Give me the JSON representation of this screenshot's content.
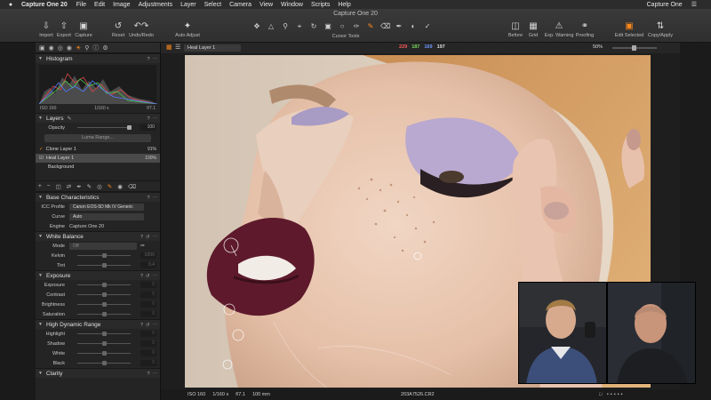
{
  "menubar": {
    "app_name": "Capture One 20",
    "items": [
      "File",
      "Edit",
      "Image",
      "Adjustments",
      "Layer",
      "Select",
      "Camera",
      "View",
      "Window",
      "Scripts",
      "Help"
    ],
    "right_title": "Capture One"
  },
  "toolbar": {
    "window_title": "Capture One 20",
    "left_buttons": [
      "Import",
      "Export",
      "Capture",
      "Reset",
      "Undo/Redo",
      "Auto Adjust"
    ],
    "cursor_tools_label": "Cursor Tools",
    "right_buttons": [
      "Before",
      "Grid",
      "Exp. Warning",
      "Proofing",
      "Edit Selected",
      "Copy/Apply"
    ]
  },
  "histogram": {
    "title": "Histogram",
    "iso": "ISO 160",
    "shutter": "1/160 s",
    "aperture": "f/7.1"
  },
  "layers": {
    "title": "Layers",
    "opacity_label": "Opacity",
    "opacity_value": "100",
    "luma_range_label": "Luma Range...",
    "items": [
      {
        "name": "Clone Layer 1",
        "pct": "91%"
      },
      {
        "name": "Heal Layer 1",
        "pct": "100%"
      },
      {
        "name": "Background",
        "pct": ""
      }
    ]
  },
  "base_characteristics": {
    "title": "Base Characteristics",
    "icc_label": "ICC Profile",
    "icc_value": "Canon EOS-5D Mk IV Generic",
    "curve_label": "Curve",
    "curve_value": "Auto",
    "engine_label": "Engine",
    "engine_value": "Capture One 20"
  },
  "white_balance": {
    "title": "White Balance",
    "mode_label": "Mode",
    "mode_value": "Off",
    "kelvin_label": "Kelvin",
    "kelvin_value": "6200",
    "tint_label": "Tint",
    "tint_value": "0.4"
  },
  "exposure": {
    "title": "Exposure",
    "rows": [
      {
        "label": "Exposure",
        "value": "0"
      },
      {
        "label": "Contrast",
        "value": "0"
      },
      {
        "label": "Brightness",
        "value": "0"
      },
      {
        "label": "Saturation",
        "value": "0"
      }
    ]
  },
  "hdr": {
    "title": "High Dynamic Range",
    "rows": [
      {
        "label": "Highlight",
        "value": "0"
      },
      {
        "label": "Shadow",
        "value": "0"
      },
      {
        "label": "White",
        "value": "0"
      },
      {
        "label": "Black",
        "value": "0"
      }
    ]
  },
  "clarity": {
    "title": "Clarity"
  },
  "viewer": {
    "layer_select": "Heal Layer 1",
    "rgb": [
      "229",
      "187",
      "169",
      "197"
    ],
    "rgb_colors": [
      "#ff5a5a",
      "#7cd95a",
      "#6d9bff",
      "#dddddd"
    ],
    "zoom": "50%",
    "bottom": {
      "iso": "ISO 160",
      "shutter": "1/160 s",
      "aperture": "f/7.1",
      "focal": "100 mm",
      "filename": "203A7526.CR2"
    }
  },
  "accent_color": "#ff8a1c"
}
